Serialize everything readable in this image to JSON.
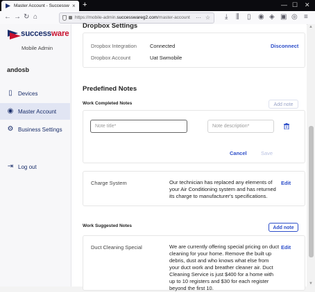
{
  "browser": {
    "tab_title": "Master Account - Successware",
    "tab_close": "×",
    "new_tab": "+",
    "url_prefix": "https://mobile-admin.",
    "url_domain": "successwareg2.com",
    "url_path": "/master-account",
    "url_more": "···",
    "url_star": "☆"
  },
  "sidebar": {
    "logo_part1": "success",
    "logo_part2": "ware",
    "subtitle": "Mobile Admin",
    "user": "andosb",
    "items": [
      {
        "label": "Devices",
        "icon": "devices-icon"
      },
      {
        "label": "Master Account",
        "icon": "user-circle-icon",
        "active": true
      },
      {
        "label": "Business Settings",
        "icon": "gear-icon"
      },
      {
        "label": "Log out",
        "icon": "logout-icon"
      }
    ]
  },
  "dropbox": {
    "title": "Dropbox Settings",
    "integration_label": "Dropbox Integration",
    "integration_value": "Connected",
    "disconnect": "Disconnect",
    "account_label": "Dropbox Account",
    "account_value": "Uat Swmobile"
  },
  "notes": {
    "title": "Predefined Notes",
    "completed": {
      "label": "Work Completed Notes",
      "add": "Add note",
      "title_placeholder": "Note title*",
      "desc_placeholder": "Note description*",
      "cancel": "Cancel",
      "save": "Save",
      "entry": {
        "title": "Charge System",
        "text": "Our technician has replaced any elements of your Air Conditioning system and has returned its charge to manufacturer's specifications.",
        "edit": "Edit"
      }
    },
    "suggested": {
      "label": "Work Suggested Notes",
      "add": "Add note",
      "entry": {
        "title": "Duct Cleaning Special",
        "text": "We are currently offering special pricing on duct cleaning for your home. Remove the built up debris, dust and who knows what else from your duct work and breather cleaner air. Duct Cleaning Service is just $400 for a home with up to 10 registers and $30 for each register beyond the first 10.",
        "edit": "Edit"
      }
    }
  },
  "colors": {
    "brand_red": "#c8102e",
    "brand_navy": "#1a2e6b",
    "link_blue": "#2d4ec9"
  }
}
